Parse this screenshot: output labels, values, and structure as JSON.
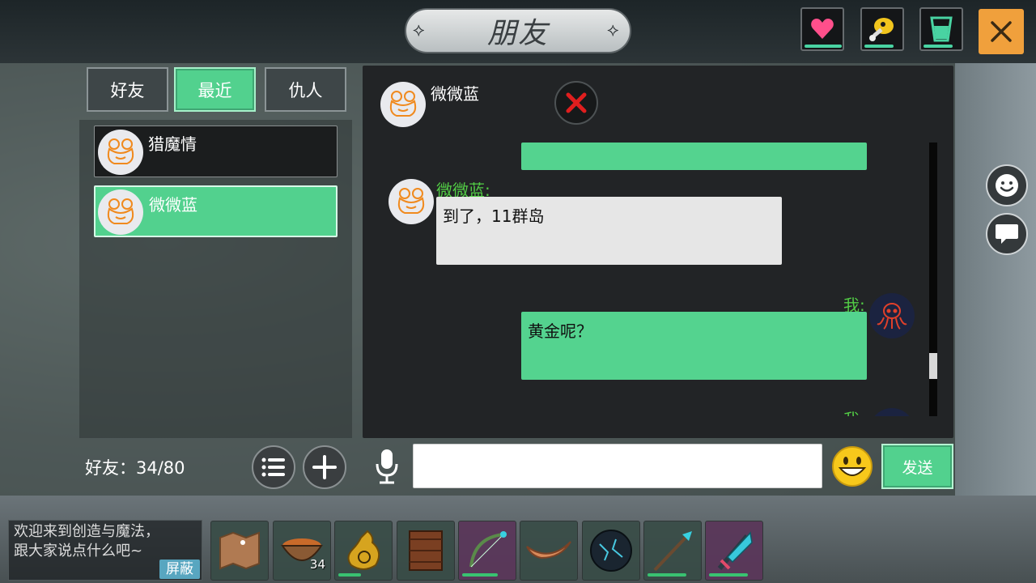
{
  "title": "朋友",
  "title_ornament_left": "⟡",
  "title_ornament_right": "⟡",
  "status_icons": [
    "heart-icon",
    "food-drumstick-icon",
    "water-cup-icon"
  ],
  "status_levels": [
    1.0,
    0.7,
    0.7
  ],
  "close_label": "✕",
  "tabs": [
    {
      "label": "好友",
      "active": false
    },
    {
      "label": "最近",
      "active": true
    },
    {
      "label": "仇人",
      "active": false
    }
  ],
  "friends": [
    {
      "name": "猎魔情",
      "selected": false
    },
    {
      "name": "微微蓝",
      "selected": true
    }
  ],
  "friend_count_label": "好友：34/80",
  "chat": {
    "partner_name": "微微蓝",
    "messages": [
      {
        "sender": "微微蓝:",
        "text": "到了，11群岛",
        "mine": false
      },
      {
        "sender": "我:",
        "text": "黄金呢？",
        "mine": true
      },
      {
        "sender": "我",
        "text": "",
        "mine": true
      }
    ],
    "input_value": "",
    "send_label": "发送"
  },
  "news_text_line1": "欢迎来到创造与魔法，",
  "news_text_line2": "跟大家说点什么吧~",
  "shield_label": "屏蔽",
  "hotbar": [
    {
      "icon": "map-icon",
      "qty": "",
      "durability": 0,
      "purple": false
    },
    {
      "icon": "stew-bowl-icon",
      "qty": "34",
      "durability": 0,
      "purple": false
    },
    {
      "icon": "gourd-flask-icon",
      "qty": "",
      "durability": 0.5,
      "purple": false
    },
    {
      "icon": "wooden-crate-icon",
      "qty": "",
      "durability": 0,
      "purple": false
    },
    {
      "icon": "bow-icon",
      "qty": "",
      "durability": 0.7,
      "purple": true
    },
    {
      "icon": "boat-icon",
      "qty": "",
      "durability": 0,
      "purple": false
    },
    {
      "icon": "orb-icon",
      "qty": "",
      "durability": 0,
      "purple": false
    },
    {
      "icon": "spear-icon",
      "qty": "",
      "durability": 0.8,
      "purple": false
    },
    {
      "icon": "crystal-sword-icon",
      "qty": "",
      "durability": 0.8,
      "purple": true
    }
  ],
  "colors": {
    "accent_green": "#52d18e",
    "sender_green": "#52cc45",
    "close_orange": "#f0a03c"
  }
}
